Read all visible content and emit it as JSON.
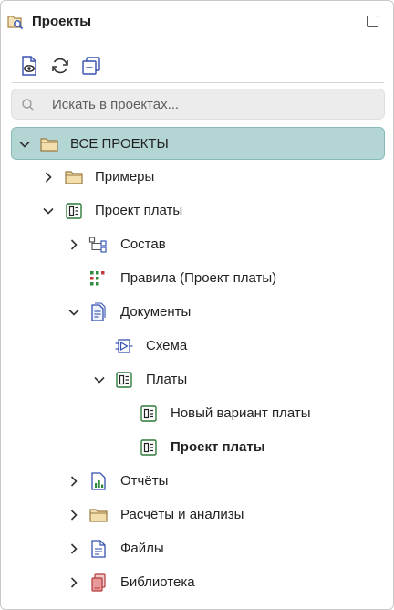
{
  "header": {
    "title": "Проекты",
    "icon": "projects-search-icon"
  },
  "toolbar": {
    "buttons": [
      "show-preview-icon",
      "refresh-icon",
      "collapse-all-icon"
    ]
  },
  "search": {
    "placeholder": "Искать в проектах..."
  },
  "tree": {
    "items": [
      {
        "label": "ВСЕ ПРОЕКТЫ",
        "expanded": true,
        "selected": true,
        "icon": "folder-icon"
      },
      {
        "label": "Примеры",
        "expanded": false,
        "icon": "folder-icon"
      },
      {
        "label": "Проект платы",
        "expanded": true,
        "icon": "board-project-icon"
      },
      {
        "label": "Состав",
        "expanded": false,
        "icon": "hierarchy-icon"
      },
      {
        "label": "Правила (Проект платы)",
        "icon": "rules-icon"
      },
      {
        "label": "Документы",
        "expanded": true,
        "icon": "documents-icon"
      },
      {
        "label": "Схема",
        "icon": "schematic-icon"
      },
      {
        "label": "Платы",
        "expanded": true,
        "icon": "board-icon"
      },
      {
        "label": "Новый вариант платы",
        "icon": "board-icon"
      },
      {
        "label": "Проект платы",
        "bold": true,
        "icon": "board-icon"
      },
      {
        "label": "Отчёты",
        "expanded": false,
        "icon": "report-icon"
      },
      {
        "label": "Расчёты и анализы",
        "expanded": false,
        "icon": "folder-icon"
      },
      {
        "label": "Файлы",
        "expanded": false,
        "icon": "file-icon"
      },
      {
        "label": "Библиотека",
        "expanded": false,
        "icon": "library-icon"
      }
    ]
  }
}
